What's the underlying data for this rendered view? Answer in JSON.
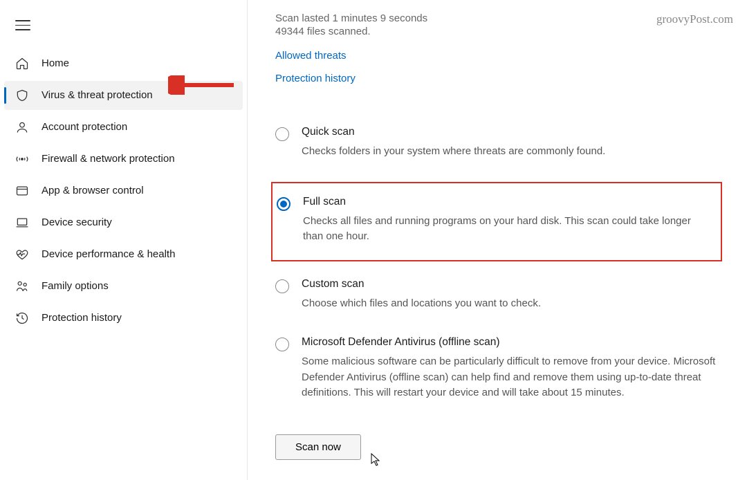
{
  "watermark": "groovyPost.com",
  "sidebar": {
    "items": [
      {
        "label": "Home"
      },
      {
        "label": "Virus & threat protection"
      },
      {
        "label": "Account protection"
      },
      {
        "label": "Firewall & network protection"
      },
      {
        "label": "App & browser control"
      },
      {
        "label": "Device security"
      },
      {
        "label": "Device performance & health"
      },
      {
        "label": "Family options"
      },
      {
        "label": "Protection history"
      }
    ]
  },
  "main": {
    "status_line1": "Scan lasted 1 minutes 9 seconds",
    "status_line2": "49344 files scanned.",
    "link_allowed": "Allowed threats",
    "link_history": "Protection history",
    "options": [
      {
        "title": "Quick scan",
        "desc": "Checks folders in your system where threats are commonly found."
      },
      {
        "title": "Full scan",
        "desc": "Checks all files and running programs on your hard disk. This scan could take longer than one hour."
      },
      {
        "title": "Custom scan",
        "desc": "Choose which files and locations you want to check."
      },
      {
        "title": "Microsoft Defender Antivirus (offline scan)",
        "desc": "Some malicious software can be particularly difficult to remove from your device. Microsoft Defender Antivirus (offline scan) can help find and remove them using up-to-date threat definitions. This will restart your device and will take about 15 minutes."
      }
    ],
    "scan_button": "Scan now"
  }
}
